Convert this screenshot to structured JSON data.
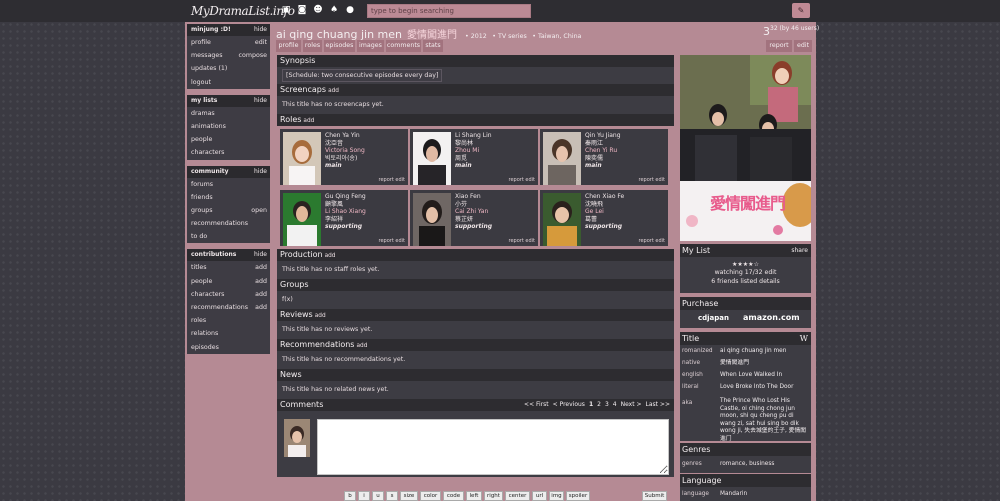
{
  "topbar": {
    "logo": "MyDramaList.info",
    "search_placeholder": "type to begin searching",
    "icons": [
      "tv-icon",
      "film-icon",
      "people-icon",
      "mask-icon",
      "footprints-icon"
    ],
    "settings_icon": "tools-icon"
  },
  "sidebar": {
    "user": {
      "header": "minjung :D!",
      "header_action": "hide",
      "items": [
        {
          "label": "profile",
          "action": "edit"
        },
        {
          "label": "messages",
          "action": "compose"
        },
        {
          "label": "updates (1)",
          "action": ""
        },
        {
          "label": "logout",
          "action": ""
        }
      ]
    },
    "mylists": {
      "header": "my lists",
      "header_action": "hide",
      "items": [
        {
          "label": "dramas"
        },
        {
          "label": "animations"
        },
        {
          "label": "people"
        },
        {
          "label": "characters"
        }
      ]
    },
    "community": {
      "header": "community",
      "header_action": "hide",
      "items": [
        {
          "label": "forums",
          "action": ""
        },
        {
          "label": "friends",
          "action": ""
        },
        {
          "label": "groups",
          "action": "open"
        },
        {
          "label": "recommendations",
          "action": ""
        },
        {
          "label": "to do",
          "action": ""
        }
      ]
    },
    "contributions": {
      "header": "contributions",
      "header_action": "hide",
      "items": [
        {
          "label": "titles",
          "action": "add"
        },
        {
          "label": "people",
          "action": "add"
        },
        {
          "label": "characters",
          "action": "add"
        },
        {
          "label": "recommendations",
          "action": "add"
        },
        {
          "label": "roles",
          "action": ""
        },
        {
          "label": "relations",
          "action": ""
        },
        {
          "label": "episodes",
          "action": ""
        }
      ]
    }
  },
  "header": {
    "title": "ai qing chuang jin men",
    "native": "愛情闖進門",
    "year": "• 2012",
    "type": "• TV series",
    "country": "• Taiwan, China",
    "vote_big": "3",
    "vote_small": "32 (by 46 users)"
  },
  "tabs": {
    "left": [
      "profile",
      "roles",
      "episodes",
      "images",
      "comments",
      "stats"
    ],
    "right": [
      "report",
      "edit"
    ]
  },
  "sections": {
    "synopsis": {
      "title": "Synopsis",
      "text": "[Schedule: two consecutive episodes every day]"
    },
    "screencaps": {
      "title": "Screencaps",
      "add": "add",
      "empty": "This title has no screencaps yet."
    },
    "roles": {
      "title": "Roles",
      "add": "add",
      "footer": "report edit",
      "cards": [
        {
          "en": "Chen Ya Yin",
          "native": "沈亞音",
          "actor": "Victoria Song",
          "actor_native": "빅토리아(송)",
          "type": "main"
        },
        {
          "en": "Li Shang Lin",
          "native": "黎尚林",
          "actor": "Zhou Mi",
          "actor_native": "周觅",
          "type": "main"
        },
        {
          "en": "Qin Yu Jiang",
          "native": "秦雨江",
          "actor": "Chen Yi Ru",
          "actor_native": "陳奕儒",
          "type": "main"
        },
        {
          "en": "Gu Qing Feng",
          "native": "顧擎風",
          "actor": "Li Shao Xiang",
          "actor_native": "李紹祥",
          "type": "supporting"
        },
        {
          "en": "Xiao Fen",
          "native": "小芬",
          "actor": "Cai Zhi Yan",
          "actor_native": "蔡芷妍",
          "type": "supporting"
        },
        {
          "en": "Chen Xiao Fe",
          "native": "沈曉飛",
          "actor": "Ge Lei",
          "actor_native": "葛蕾",
          "type": "supporting"
        }
      ]
    },
    "production": {
      "title": "Production",
      "add": "add",
      "empty": "This title has no staff roles yet."
    },
    "groups": {
      "title": "Groups",
      "text": "f(x)"
    },
    "reviews": {
      "title": "Reviews",
      "add": "add",
      "empty": "This title has no reviews yet."
    },
    "recommendations": {
      "title": "Recommendations",
      "add": "add",
      "empty": "This title has no recommendations yet."
    },
    "news": {
      "title": "News",
      "empty": "This title has no related news yet."
    },
    "comments": {
      "title": "Comments",
      "pager": [
        "<< First",
        "< Previous",
        "1",
        "2",
        "3",
        "4",
        "Next >",
        "Last >>"
      ]
    }
  },
  "editor_buttons": [
    "b",
    "i",
    "u",
    "s",
    "size",
    "color",
    "code",
    "left",
    "right",
    "center",
    "url",
    "img",
    "spoiler"
  ],
  "submit": "Submit",
  "right": {
    "poster_text": "愛情闖進門",
    "mylist": {
      "title": "My List",
      "action": "share",
      "stars": "★★★★☆",
      "status": "watching 17/32",
      "status_action": "edit",
      "friends": "6 friends listed",
      "friends_action": "details"
    },
    "purchase": {
      "title": "Purchase",
      "store1": "cdjapan",
      "store2": "amazon.com"
    },
    "titlebox": {
      "title": "Title",
      "icon": "W",
      "rows": [
        {
          "k": "romanized",
          "v": "ai qing chuang jin men"
        },
        {
          "k": "native",
          "v": "愛情闖進門"
        },
        {
          "k": "english",
          "v": "When Love Walked In"
        },
        {
          "k": "literal",
          "v": "Love Broke Into The Door"
        },
        {
          "k": "aka",
          "v": "The Prince Who Lost His Castle, oi ching chong jun moon, shi qu cheng pu di wang zi, sat hui sing bo dik wong ji, 失去城堡的王子, 愛情闖進门"
        }
      ]
    },
    "genres": {
      "title": "Genres",
      "k": "genres",
      "v": "romance, business"
    },
    "language": {
      "title": "Language",
      "k": "language",
      "v": "Mandarin"
    }
  }
}
